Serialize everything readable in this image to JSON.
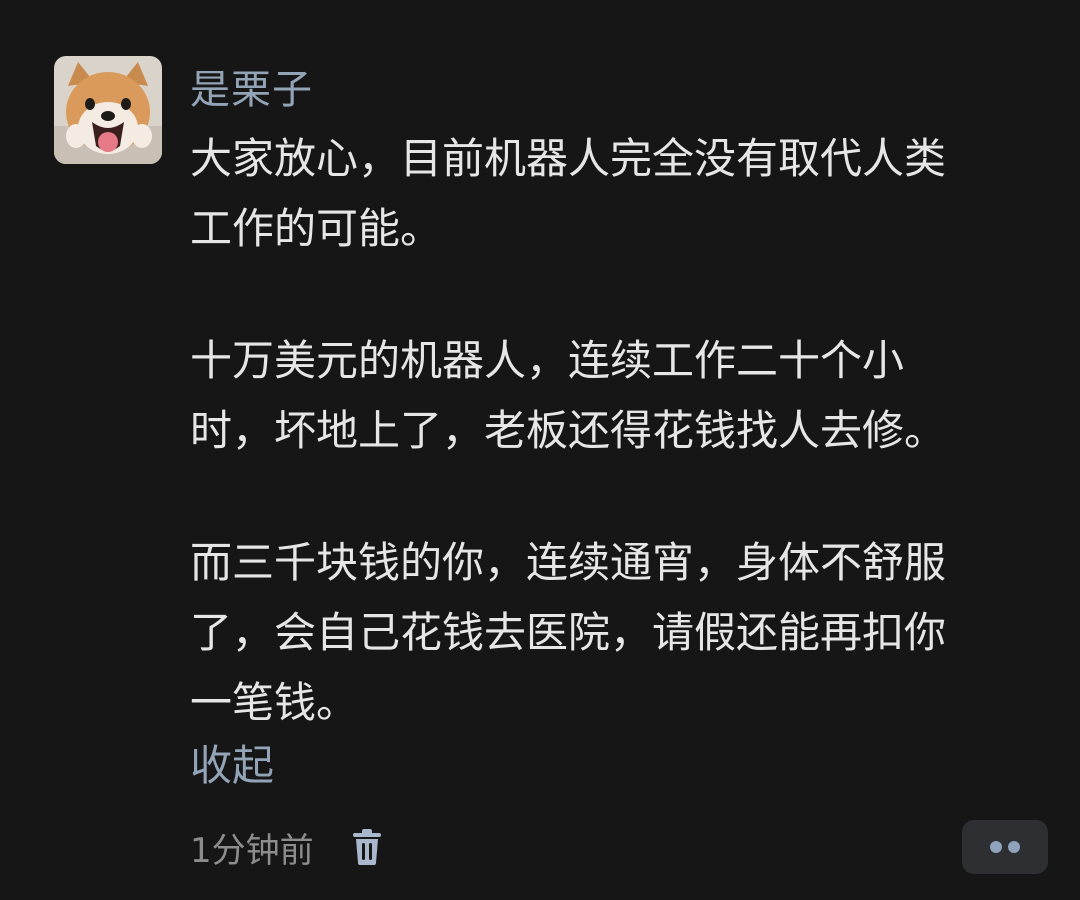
{
  "comment": {
    "username": "是栗子",
    "avatar_icon": "shiba-dog-avatar",
    "paragraphs": [
      [
        "大家放心，目前机器人完全没有取代人类",
        "工作的可能。"
      ],
      [
        "十万美元的机器人，连续工作二十个小",
        "时，坏地上了，老板还得花钱找人去修。"
      ],
      [
        "而三千块钱的你，连续通宵，身体不舒服",
        "了，会自己花钱去医院，请假还能再扣你",
        "一笔钱。"
      ]
    ],
    "collapse_label": "收起",
    "timestamp": "1分钟前",
    "delete_icon": "trash-icon",
    "more_icon": "more-dots-icon"
  },
  "colors": {
    "background": "#161616",
    "text": "#e6e6e6",
    "accent": "#93a4b7",
    "muted": "#8d8d8d"
  }
}
